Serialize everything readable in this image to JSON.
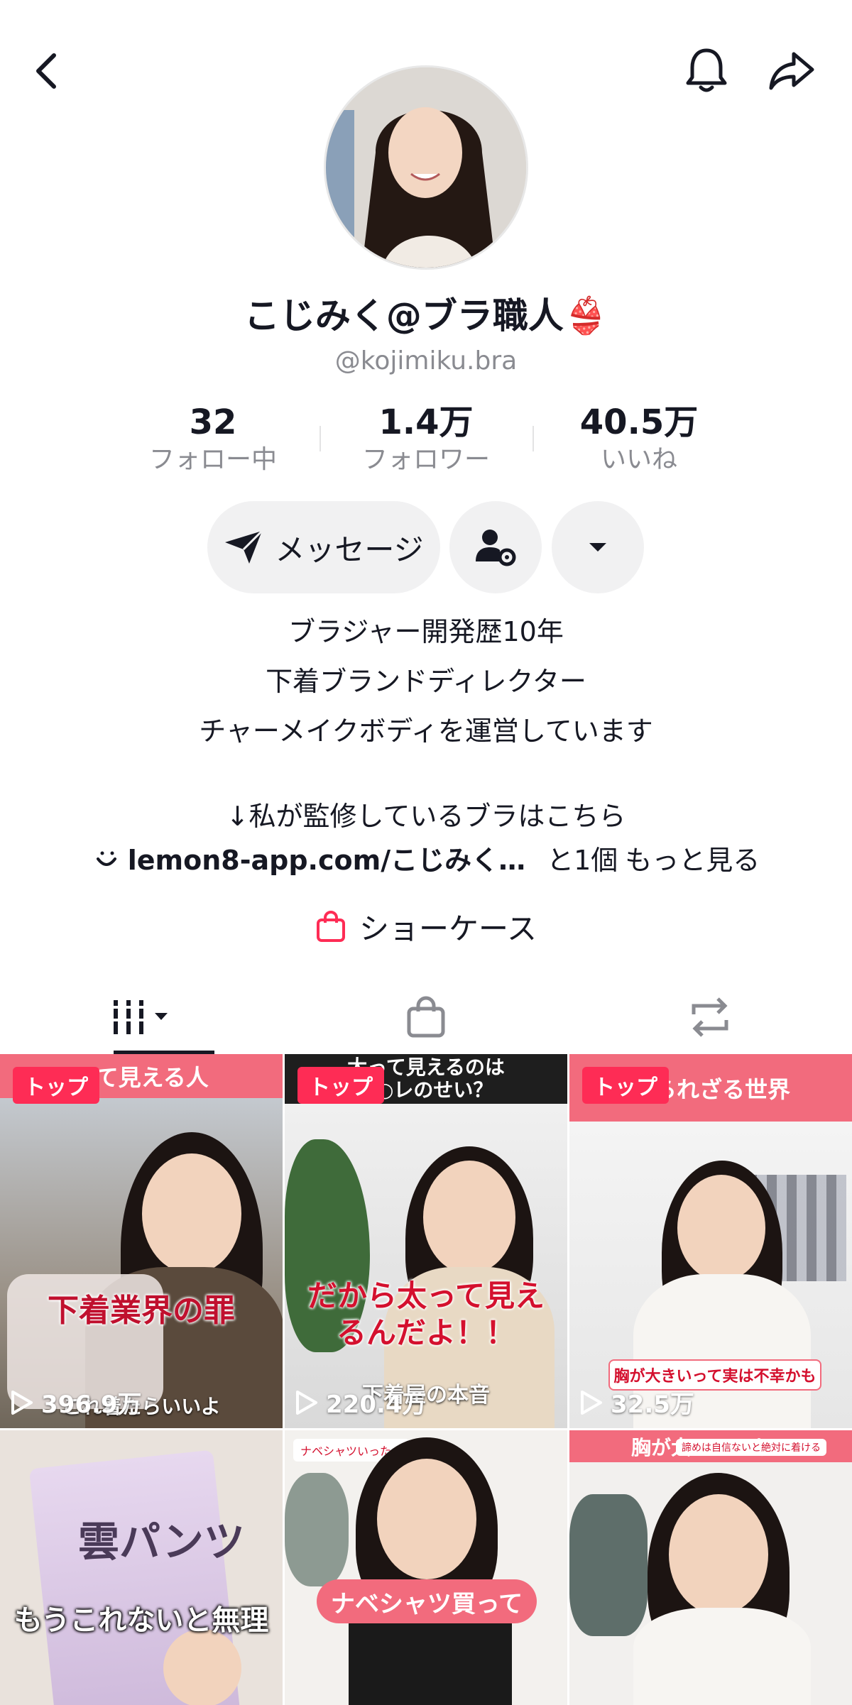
{
  "header": {
    "back_icon": "chevron-left-icon",
    "bell_icon": "bell-icon",
    "share_icon": "share-arrow-icon"
  },
  "profile": {
    "display_name": "こじみく@ブラ職人",
    "name_emoji": "👙",
    "username": "@kojimiku.bra"
  },
  "stats": [
    {
      "value": "32",
      "label": "フォロー中"
    },
    {
      "value": "1.4万",
      "label": "フォロワー"
    },
    {
      "value": "40.5万",
      "label": "いいね"
    }
  ],
  "actions": {
    "message_label": "メッセージ"
  },
  "bio": {
    "line1": "ブラジャー開発歴10年",
    "line2": "下着ブランドディレクター",
    "line3": "チャーメイクボディを運営しています",
    "line4": "↓私が監修しているブラはこちら",
    "link_text": "lemon8-app.com/こじみく…",
    "link_extra": "と1個",
    "more_label": "もっと見る"
  },
  "showcase": {
    "label": "ショーケース"
  },
  "tabs": [
    "videos-grid",
    "shop",
    "reposts"
  ],
  "videos": [
    {
      "badge": "トップ",
      "banner": "って見える人",
      "caption": "下着業界の罪",
      "views": "396.9万",
      "overlay": "これ着たらいいよ"
    },
    {
      "badge": "トップ",
      "banner": "太って見えるのは",
      "banner2": "○○レのせい？",
      "caption": "だから太って見えるんだよ！！",
      "views": "220.4万",
      "overlay": "下着屋の本音"
    },
    {
      "badge": "トップ",
      "banner": "知られざる世界",
      "caption": "胸が大きいって実は不幸かも",
      "views": "32.5万"
    },
    {
      "caption": "もうこれないと無理",
      "package": "雲パンツ"
    },
    {
      "caption": "ナベシャツ買って",
      "tag": "ナベシャツいったく"
    },
    {
      "banner": "胸が大　　　ある",
      "tag": "諦めは自信ないと絶対に着ける"
    }
  ],
  "colors": {
    "accent": "#fe2c55",
    "text": "#161823",
    "muted": "#8a8b91",
    "button_bg": "#f1f1f2"
  }
}
